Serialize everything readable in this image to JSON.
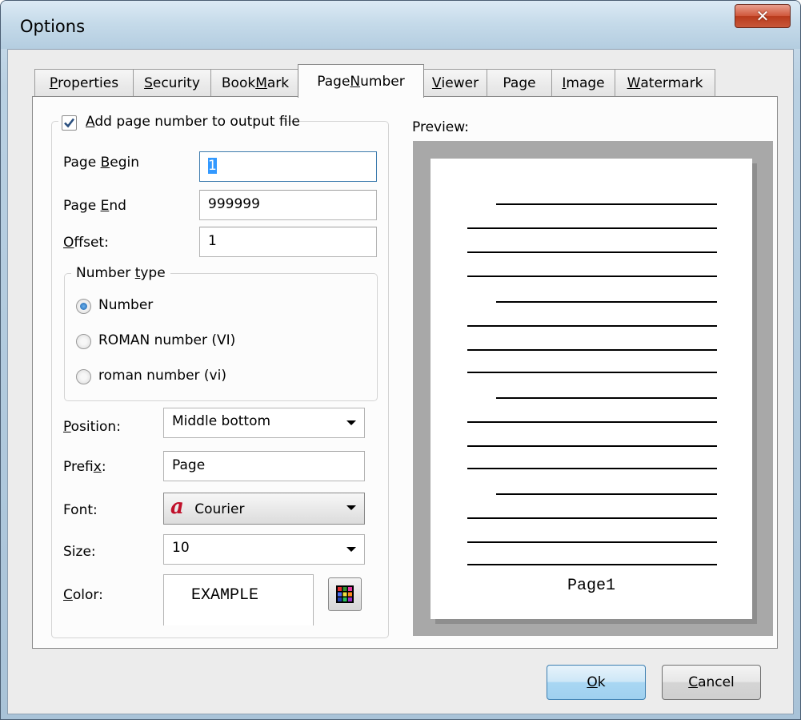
{
  "window": {
    "title": "Options"
  },
  "tabs": [
    {
      "label_pre": "",
      "mnemonic": "P",
      "label_post": "roperties"
    },
    {
      "label_pre": "",
      "mnemonic": "S",
      "label_post": "ecurity"
    },
    {
      "label_pre": "Book",
      "mnemonic": "M",
      "label_post": "ark"
    },
    {
      "label_pre": "Page ",
      "mnemonic": "N",
      "label_post": "umber"
    },
    {
      "label_pre": "",
      "mnemonic": "V",
      "label_post": "iewer"
    },
    {
      "label_pre": "Pa",
      "mnemonic": "g",
      "label_post": "e"
    },
    {
      "label_pre": "",
      "mnemonic": "I",
      "label_post": "mage"
    },
    {
      "label_pre": "",
      "mnemonic": "W",
      "label_post": "atermark"
    }
  ],
  "active_tab": "Page Number",
  "add_page_number": {
    "label_pre": "",
    "mnemonic": "A",
    "label_post": "dd page number to output file",
    "checked": true
  },
  "page_begin": {
    "label_pre": "Page ",
    "mnemonic": "B",
    "label_post": "egin",
    "value": "1"
  },
  "page_end": {
    "label_pre": "Page ",
    "mnemonic": "E",
    "label_post": "nd",
    "value": "999999"
  },
  "offset": {
    "label_pre": "",
    "mnemonic": "O",
    "label_post": "ffset:",
    "value": "1"
  },
  "number_type": {
    "legend_pre": "Number ",
    "legend_mnemonic": "t",
    "legend_post": "ype",
    "options": [
      "Number",
      "ROMAN number (VI)",
      "roman number (vi)"
    ],
    "selected": "Number"
  },
  "position": {
    "label_pre": "",
    "mnemonic": "P",
    "label_post": "osition:",
    "value": "Middle bottom"
  },
  "prefix": {
    "label_pre": "Prefi",
    "mnemonic": "x",
    "label_post": ":",
    "value": "Page"
  },
  "font": {
    "label": "Font:",
    "icon_glyph": "a",
    "value": "Courier"
  },
  "size": {
    "label": "Size:",
    "value": "10"
  },
  "color": {
    "label_pre": "",
    "mnemonic": "C",
    "label_post": "olor:",
    "sample": "EXAMPLE"
  },
  "preview": {
    "label": "Preview:",
    "page_text": "Page1"
  },
  "buttons": {
    "ok": {
      "label_pre": "",
      "mnemonic": "O",
      "label_post": "k"
    },
    "cancel": {
      "label_pre": "",
      "mnemonic": "C",
      "label_post": "ancel"
    }
  },
  "colors": {
    "accent": "#3d7bad",
    "font_icon": "#c0102a",
    "close_button": "#c8583a"
  }
}
